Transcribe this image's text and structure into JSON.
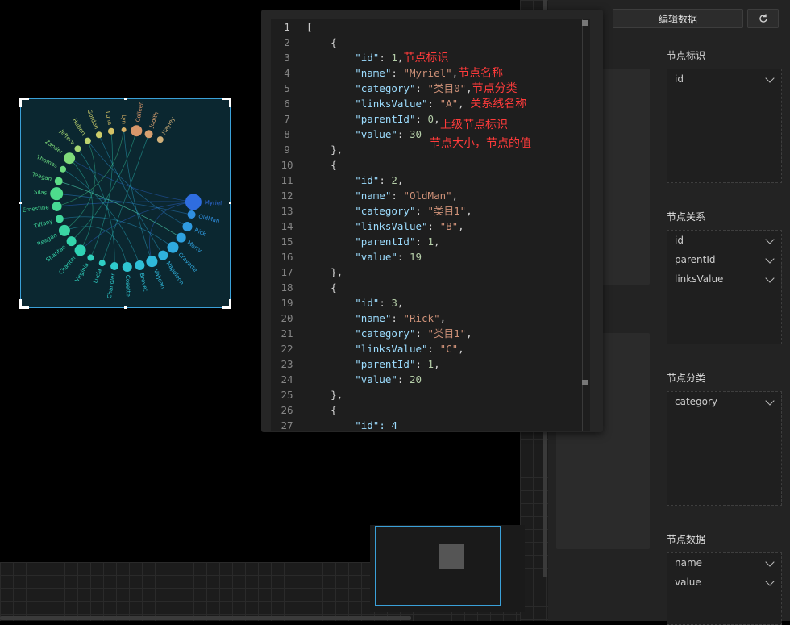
{
  "editor": {
    "lines": [
      {
        "n": "1",
        "segs": [
          {
            "t": "[",
            "c": "p"
          }
        ]
      },
      {
        "n": "2",
        "segs": [
          {
            "t": "    {",
            "c": "p"
          }
        ]
      },
      {
        "n": "3",
        "segs": [
          {
            "t": "        ",
            "c": "p"
          },
          {
            "t": "\"id\"",
            "c": "k"
          },
          {
            "t": ": ",
            "c": "p"
          },
          {
            "t": "1",
            "c": "n"
          },
          {
            "t": ",",
            "c": "p"
          },
          {
            "t": "节点标识",
            "c": "ann"
          }
        ]
      },
      {
        "n": "4",
        "segs": [
          {
            "t": "        ",
            "c": "p"
          },
          {
            "t": "\"name\"",
            "c": "k"
          },
          {
            "t": ": ",
            "c": "p"
          },
          {
            "t": "\"Myriel\"",
            "c": "s"
          },
          {
            "t": ",",
            "c": "p"
          },
          {
            "t": "节点名称",
            "c": "ann"
          }
        ]
      },
      {
        "n": "5",
        "segs": [
          {
            "t": "        ",
            "c": "p"
          },
          {
            "t": "\"category\"",
            "c": "k"
          },
          {
            "t": ": ",
            "c": "p"
          },
          {
            "t": "\"类目0\"",
            "c": "s"
          },
          {
            "t": ",",
            "c": "p"
          },
          {
            "t": "节点分类",
            "c": "ann"
          }
        ]
      },
      {
        "n": "6",
        "segs": [
          {
            "t": "        ",
            "c": "p"
          },
          {
            "t": "\"linksValue\"",
            "c": "k"
          },
          {
            "t": ": ",
            "c": "p"
          },
          {
            "t": "\"A\"",
            "c": "s"
          },
          {
            "t": ", ",
            "c": "p"
          },
          {
            "t": "关系线名称",
            "c": "ann"
          }
        ]
      },
      {
        "n": "7",
        "segs": [
          {
            "t": "        ",
            "c": "p"
          },
          {
            "t": "\"parentId\"",
            "c": "k"
          },
          {
            "t": ": ",
            "c": "p"
          },
          {
            "t": "0",
            "c": "n"
          },
          {
            "t": ",",
            "c": "p"
          }
        ]
      },
      {
        "n": "8",
        "segs": [
          {
            "t": "        ",
            "c": "p"
          },
          {
            "t": "\"value\"",
            "c": "k"
          },
          {
            "t": ": ",
            "c": "p"
          },
          {
            "t": "30",
            "c": "n"
          }
        ]
      },
      {
        "n": "9",
        "segs": [
          {
            "t": "    },",
            "c": "p"
          }
        ]
      },
      {
        "n": "10",
        "segs": [
          {
            "t": "    {",
            "c": "p"
          }
        ]
      },
      {
        "n": "11",
        "segs": [
          {
            "t": "        ",
            "c": "p"
          },
          {
            "t": "\"id\"",
            "c": "k"
          },
          {
            "t": ": ",
            "c": "p"
          },
          {
            "t": "2",
            "c": "n"
          },
          {
            "t": ",",
            "c": "p"
          }
        ]
      },
      {
        "n": "12",
        "segs": [
          {
            "t": "        ",
            "c": "p"
          },
          {
            "t": "\"name\"",
            "c": "k"
          },
          {
            "t": ": ",
            "c": "p"
          },
          {
            "t": "\"OldMan\"",
            "c": "s"
          },
          {
            "t": ",",
            "c": "p"
          }
        ]
      },
      {
        "n": "13",
        "segs": [
          {
            "t": "        ",
            "c": "p"
          },
          {
            "t": "\"category\"",
            "c": "k"
          },
          {
            "t": ": ",
            "c": "p"
          },
          {
            "t": "\"类目1\"",
            "c": "s"
          },
          {
            "t": ",",
            "c": "p"
          }
        ]
      },
      {
        "n": "14",
        "segs": [
          {
            "t": "        ",
            "c": "p"
          },
          {
            "t": "\"linksValue\"",
            "c": "k"
          },
          {
            "t": ": ",
            "c": "p"
          },
          {
            "t": "\"B\"",
            "c": "s"
          },
          {
            "t": ",",
            "c": "p"
          }
        ]
      },
      {
        "n": "15",
        "segs": [
          {
            "t": "        ",
            "c": "p"
          },
          {
            "t": "\"parentId\"",
            "c": "k"
          },
          {
            "t": ": ",
            "c": "p"
          },
          {
            "t": "1",
            "c": "n"
          },
          {
            "t": ",",
            "c": "p"
          }
        ]
      },
      {
        "n": "16",
        "segs": [
          {
            "t": "        ",
            "c": "p"
          },
          {
            "t": "\"value\"",
            "c": "k"
          },
          {
            "t": ": ",
            "c": "p"
          },
          {
            "t": "19",
            "c": "n"
          }
        ]
      },
      {
        "n": "17",
        "segs": [
          {
            "t": "    },",
            "c": "p"
          }
        ]
      },
      {
        "n": "18",
        "segs": [
          {
            "t": "    {",
            "c": "p"
          }
        ]
      },
      {
        "n": "19",
        "segs": [
          {
            "t": "        ",
            "c": "p"
          },
          {
            "t": "\"id\"",
            "c": "k"
          },
          {
            "t": ": ",
            "c": "p"
          },
          {
            "t": "3",
            "c": "n"
          },
          {
            "t": ",",
            "c": "p"
          }
        ]
      },
      {
        "n": "20",
        "segs": [
          {
            "t": "        ",
            "c": "p"
          },
          {
            "t": "\"name\"",
            "c": "k"
          },
          {
            "t": ": ",
            "c": "p"
          },
          {
            "t": "\"Rick\"",
            "c": "s"
          },
          {
            "t": ",",
            "c": "p"
          }
        ]
      },
      {
        "n": "21",
        "segs": [
          {
            "t": "        ",
            "c": "p"
          },
          {
            "t": "\"category\"",
            "c": "k"
          },
          {
            "t": ": ",
            "c": "p"
          },
          {
            "t": "\"类目1\"",
            "c": "s"
          },
          {
            "t": ",",
            "c": "p"
          }
        ]
      },
      {
        "n": "22",
        "segs": [
          {
            "t": "        ",
            "c": "p"
          },
          {
            "t": "\"linksValue\"",
            "c": "k"
          },
          {
            "t": ": ",
            "c": "p"
          },
          {
            "t": "\"C\"",
            "c": "s"
          },
          {
            "t": ",",
            "c": "p"
          }
        ]
      },
      {
        "n": "23",
        "segs": [
          {
            "t": "        ",
            "c": "p"
          },
          {
            "t": "\"parentId\"",
            "c": "k"
          },
          {
            "t": ": ",
            "c": "p"
          },
          {
            "t": "1",
            "c": "n"
          },
          {
            "t": ",",
            "c": "p"
          }
        ]
      },
      {
        "n": "24",
        "segs": [
          {
            "t": "        ",
            "c": "p"
          },
          {
            "t": "\"value\"",
            "c": "k"
          },
          {
            "t": ": ",
            "c": "p"
          },
          {
            "t": "20",
            "c": "n"
          }
        ]
      },
      {
        "n": "25",
        "segs": [
          {
            "t": "    },",
            "c": "p"
          }
        ]
      },
      {
        "n": "26",
        "segs": [
          {
            "t": "    {",
            "c": "p"
          }
        ]
      },
      {
        "n": "27",
        "segs": [
          {
            "t": "        ",
            "c": "p"
          },
          {
            "t": "\"id\": 4",
            "c": "k"
          }
        ]
      }
    ],
    "annot_parent": "上级节点标识",
    "annot_value": "节点大小，节点的值"
  },
  "toolbar": {
    "edit_data_label": "编辑数据",
    "refresh_icon": "refresh-icon"
  },
  "panel": {
    "node_id_title": "节点标识",
    "node_id_fields": [
      "id"
    ],
    "relation_title": "节点关系",
    "relation_fields": [
      "id",
      "parentId",
      "linksValue"
    ],
    "category_title": "节点分类",
    "category_fields": [
      "category"
    ],
    "data_title": "节点数据",
    "data_fields": [
      "name",
      "value"
    ]
  },
  "chart_data": {
    "type": "graph-circular",
    "nodes": [
      {
        "name": "Myriel",
        "color": "#2f6de0",
        "value": 30
      },
      {
        "name": "OldMan",
        "color": "#2f8fe0"
      },
      {
        "name": "Rick",
        "color": "#2f9ae0"
      },
      {
        "name": "Morty",
        "color": "#2fa2e0"
      },
      {
        "name": "Cravatte",
        "color": "#2faadf"
      },
      {
        "name": "Napoleon",
        "color": "#2fb2de"
      },
      {
        "name": "Valjean",
        "color": "#2fbadc"
      },
      {
        "name": "Brevet",
        "color": "#2fc0d8"
      },
      {
        "name": "Cosette",
        "color": "#2fc6d2"
      },
      {
        "name": "Chandler",
        "color": "#2fcacc"
      },
      {
        "name": "Lucia",
        "color": "#2fcec4"
      },
      {
        "name": "Virginia",
        "color": "#2fd0bc"
      },
      {
        "name": "Chantel",
        "color": "#2fd2b4"
      },
      {
        "name": "Shantae",
        "color": "#34d4ac"
      },
      {
        "name": "Reagan",
        "color": "#3ad6a4"
      },
      {
        "name": "Tiffany",
        "color": "#40d89c"
      },
      {
        "name": "Ernestine",
        "color": "#46da94"
      },
      {
        "name": "Silas",
        "color": "#4edc8c"
      },
      {
        "name": "Teagan",
        "color": "#5cdc86"
      },
      {
        "name": "Thomas",
        "color": "#6cdc80"
      },
      {
        "name": "Zander",
        "color": "#80dc7a"
      },
      {
        "name": "Jeffery",
        "color": "#a6d874"
      },
      {
        "name": "Hubert",
        "color": "#bcd46e"
      },
      {
        "name": "Gordon",
        "color": "#cccc6a"
      },
      {
        "name": "Luna",
        "color": "#d4c266"
      },
      {
        "name": "Lyn",
        "color": "#d8b066"
      },
      {
        "name": "Colleen",
        "color": "#d8966a"
      },
      {
        "name": "Judith",
        "color": "#d8a070"
      },
      {
        "name": "Hayley",
        "color": "#d0b07a"
      }
    ]
  }
}
